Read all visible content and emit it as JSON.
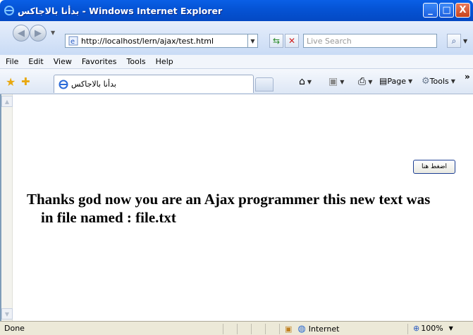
{
  "window": {
    "title": "بدأنا بالاجاكس - Windows Internet Explorer",
    "minimize_label": "_",
    "maximize_label": "□",
    "close_label": "X"
  },
  "address_bar": {
    "url": "http://localhost/lern/ajax/test.html",
    "search_placeholder": "Live Search"
  },
  "menu": {
    "items": [
      "File",
      "Edit",
      "View",
      "Favorites",
      "Tools",
      "Help"
    ]
  },
  "tab": {
    "label": "بدأنا بالاجاكس"
  },
  "command_bar": {
    "page_label": "Page",
    "tools_label": "Tools",
    "overflow_label": "»"
  },
  "page": {
    "button_label": "اضغط هنا",
    "result_text": "Thanks god now you are an Ajax programmer this new text was in file named : file.txt"
  },
  "status_bar": {
    "status": "Done",
    "zone": "Internet",
    "zoom": "100%"
  },
  "icons": {
    "app": "ie-icon",
    "back": "back-arrow-icon",
    "forward": "forward-arrow-icon",
    "refresh": "refresh-icon",
    "stop": "stop-icon",
    "search": "magnifier-icon",
    "favorites": "favorites-star-icon",
    "add_favorites": "add-favorites-icon",
    "home": "home-icon",
    "feeds": "feeds-icon",
    "print": "print-icon",
    "page": "page-icon",
    "tools": "gear-icon",
    "globe": "globe-icon",
    "protected_mode": "lock-icon",
    "zoom": "magnifier-icon"
  },
  "colors": {
    "title_bar": "#0554d6",
    "chrome": "#dde7f5",
    "status_bar": "#ece9d8"
  }
}
